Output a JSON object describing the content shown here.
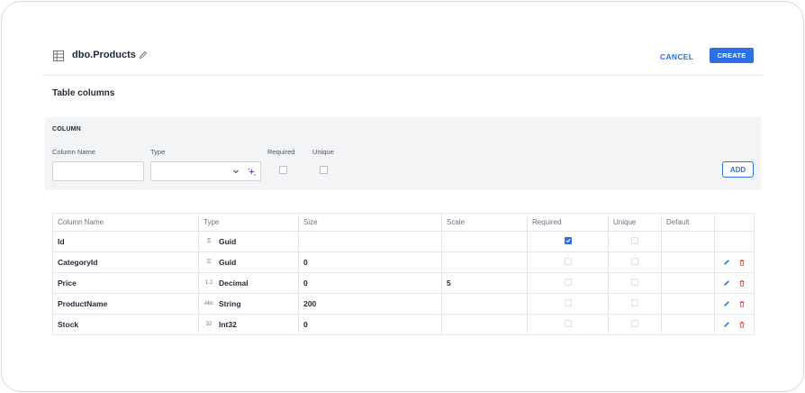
{
  "header": {
    "title": "dbo.Products",
    "cancel_label": "CANCEL",
    "create_label": "CREATE"
  },
  "section_title": "Table columns",
  "column_form": {
    "heading": "COLUMN",
    "column_name_label": "Column Name",
    "column_name_value": "",
    "type_label": "Type",
    "type_value": "",
    "required_label": "Required",
    "required_checked": false,
    "unique_label": "Unique",
    "unique_checked": false,
    "add_label": "ADD"
  },
  "table": {
    "headers": [
      "Column Name",
      "Type",
      "Size",
      "Scale",
      "Required",
      "Unique",
      "Default",
      ""
    ],
    "rows": [
      {
        "name": "Id",
        "type_icon": "guid-key-icon",
        "type_glyph": "⚿",
        "type": "Guid",
        "size": "",
        "scale": "",
        "required": true,
        "unique": false,
        "default": "",
        "actions": false
      },
      {
        "name": "CategoryId",
        "type_icon": "guid-key-icon",
        "type_glyph": "⚿",
        "type": "Guid",
        "size": "0",
        "scale": "",
        "required": false,
        "unique": false,
        "default": "",
        "actions": true
      },
      {
        "name": "Price",
        "type_icon": "decimal-icon",
        "type_glyph": "1.2",
        "type": "Decimal",
        "size": "0",
        "scale": "5",
        "required": false,
        "unique": false,
        "default": "",
        "actions": true
      },
      {
        "name": "ProductName",
        "type_icon": "string-icon",
        "type_glyph": "Abc",
        "type": "String",
        "size": "200",
        "scale": "",
        "required": false,
        "unique": false,
        "default": "",
        "actions": true
      },
      {
        "name": "Stock",
        "type_icon": "integer-icon",
        "type_glyph": "32",
        "type": "Int32",
        "size": "0",
        "scale": "",
        "required": false,
        "unique": false,
        "default": "",
        "actions": true
      }
    ]
  },
  "colors": {
    "accent": "#2f6fe4",
    "delete": "#e53e3e",
    "panel_bg": "#f3f4f6"
  }
}
